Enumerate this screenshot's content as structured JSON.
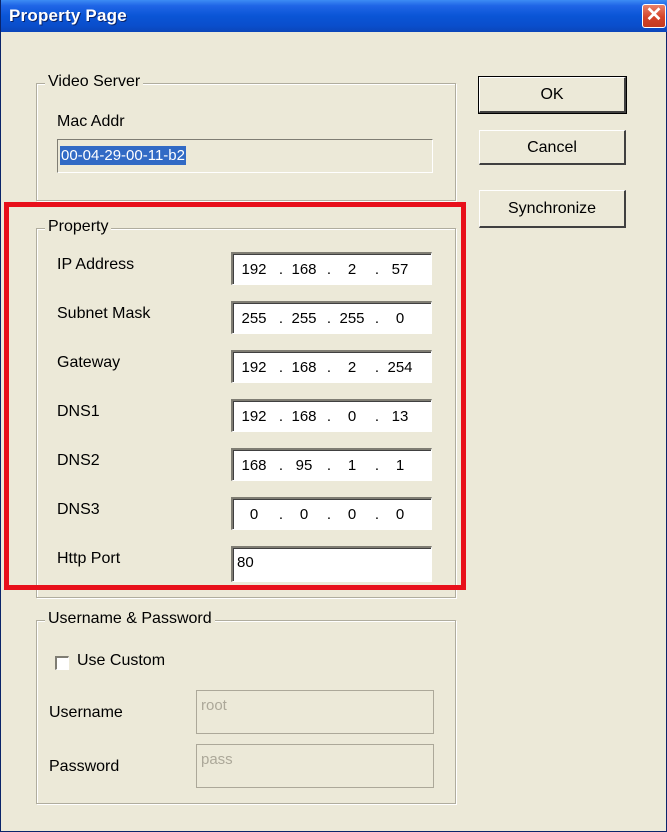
{
  "window": {
    "title": "Property Page",
    "close_glyph": "✕"
  },
  "video_server": {
    "legend": "Video Server",
    "mac_label": "Mac Addr",
    "mac_value": "00-04-29-00-11-b2"
  },
  "buttons": {
    "ok": "OK",
    "cancel": "Cancel",
    "synchronize": "Synchronize"
  },
  "property": {
    "legend": "Property",
    "fields": [
      {
        "label": "IP Address",
        "octets": [
          "192",
          "168",
          "2",
          "57"
        ]
      },
      {
        "label": "Subnet Mask",
        "octets": [
          "255",
          "255",
          "255",
          "0"
        ]
      },
      {
        "label": "Gateway",
        "octets": [
          "192",
          "168",
          "2",
          "254"
        ]
      },
      {
        "label": "DNS1",
        "octets": [
          "192",
          "168",
          "0",
          "13"
        ]
      },
      {
        "label": "DNS2",
        "octets": [
          "168",
          "95",
          "1",
          "1"
        ]
      },
      {
        "label": "DNS3",
        "octets": [
          "0",
          "0",
          "0",
          "0"
        ]
      }
    ],
    "http_port_label": "Http Port",
    "http_port_value": "80"
  },
  "credentials": {
    "legend": "Username & Password",
    "use_custom_label": "Use Custom",
    "use_custom_checked": false,
    "username_label": "Username",
    "username_value": "root",
    "password_label": "Password",
    "password_value": "pass"
  },
  "colors": {
    "highlight_box": "#e8101b",
    "titlebar": "#0a55d6",
    "selection": "#316ac5"
  },
  "icons": {
    "close": "close-icon"
  }
}
